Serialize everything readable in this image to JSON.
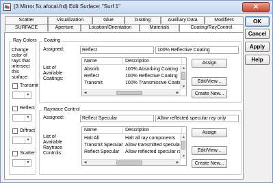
{
  "window": {
    "title": "(3 Mirror 5x afocal.frd) Edit Surface: \"Surf 1\"",
    "close_glyph": "✕"
  },
  "tabs_row1": [
    "Scatter",
    "Visualization",
    "Glue",
    "Grating",
    "Auxiliary Data",
    "Modifiers"
  ],
  "tabs_row2": [
    "SURFACE",
    "Aperture",
    "Location/Orientation",
    "Materials",
    "Coating/RayControl"
  ],
  "active_tab": "Coating/RayControl",
  "side_buttons": {
    "ok": "OK",
    "cancel": "Cancel",
    "apply": "Apply",
    "help": "Help"
  },
  "ray_colors": {
    "title": "Ray Colors",
    "description": "Change color of rays that intersect this surface:",
    "items": [
      {
        "label": "Transmit"
      },
      {
        "label": "Reflect"
      },
      {
        "label": "Diffract"
      },
      {
        "label": "Scatter"
      }
    ]
  },
  "coating": {
    "title": "Coating",
    "assigned_label": "Assigned:",
    "assigned_value": "Reflect",
    "assigned_description": "100% Reflective Coating",
    "list_label": "List of Available Coatings:",
    "columns": [
      "Name",
      "Description"
    ],
    "rows": [
      [
        "Absorb",
        "100% Absorbing Coating"
      ],
      [
        "Reflect",
        "100% Reflective Coating"
      ],
      [
        "Transmit",
        "100% Transmissive Coating"
      ]
    ],
    "buttons": {
      "assign": "Assign",
      "edit_view": "Edit/View...",
      "create_new": "Create New..."
    }
  },
  "raytrace": {
    "title": "Raytrace Control",
    "assigned_label": "Assigned:",
    "assigned_value": "Reflect Specular",
    "assigned_description": "Allow reflected specular ray only",
    "list_label": "List of Available Raytrace Controls:",
    "columns": [
      "Name",
      "Description"
    ],
    "rows": [
      [
        "Halt All",
        "Halt all ray components"
      ],
      [
        "Transmit Specular",
        "Allow transmitted specular r"
      ],
      [
        "Reflect Specular",
        "Allow reflected specular ray"
      ]
    ],
    "buttons": {
      "assign": "Assign",
      "edit_view": "Edit/View...",
      "create_new": "Create New..."
    }
  },
  "icons": {
    "app": "app-icon",
    "close": "close-icon",
    "scroll_up": "scroll-up-arrow-icon",
    "scroll_down": "scroll-down-arrow-icon",
    "scroll_left": "scroll-left-arrow-icon",
    "scroll_right": "scroll-right-arrow-icon",
    "dropdown": "chevron-down-icon"
  },
  "colors": {
    "titlebar": "#c4d7ef",
    "close_button": "#c84530",
    "default_button_border": "#3a78c8"
  }
}
